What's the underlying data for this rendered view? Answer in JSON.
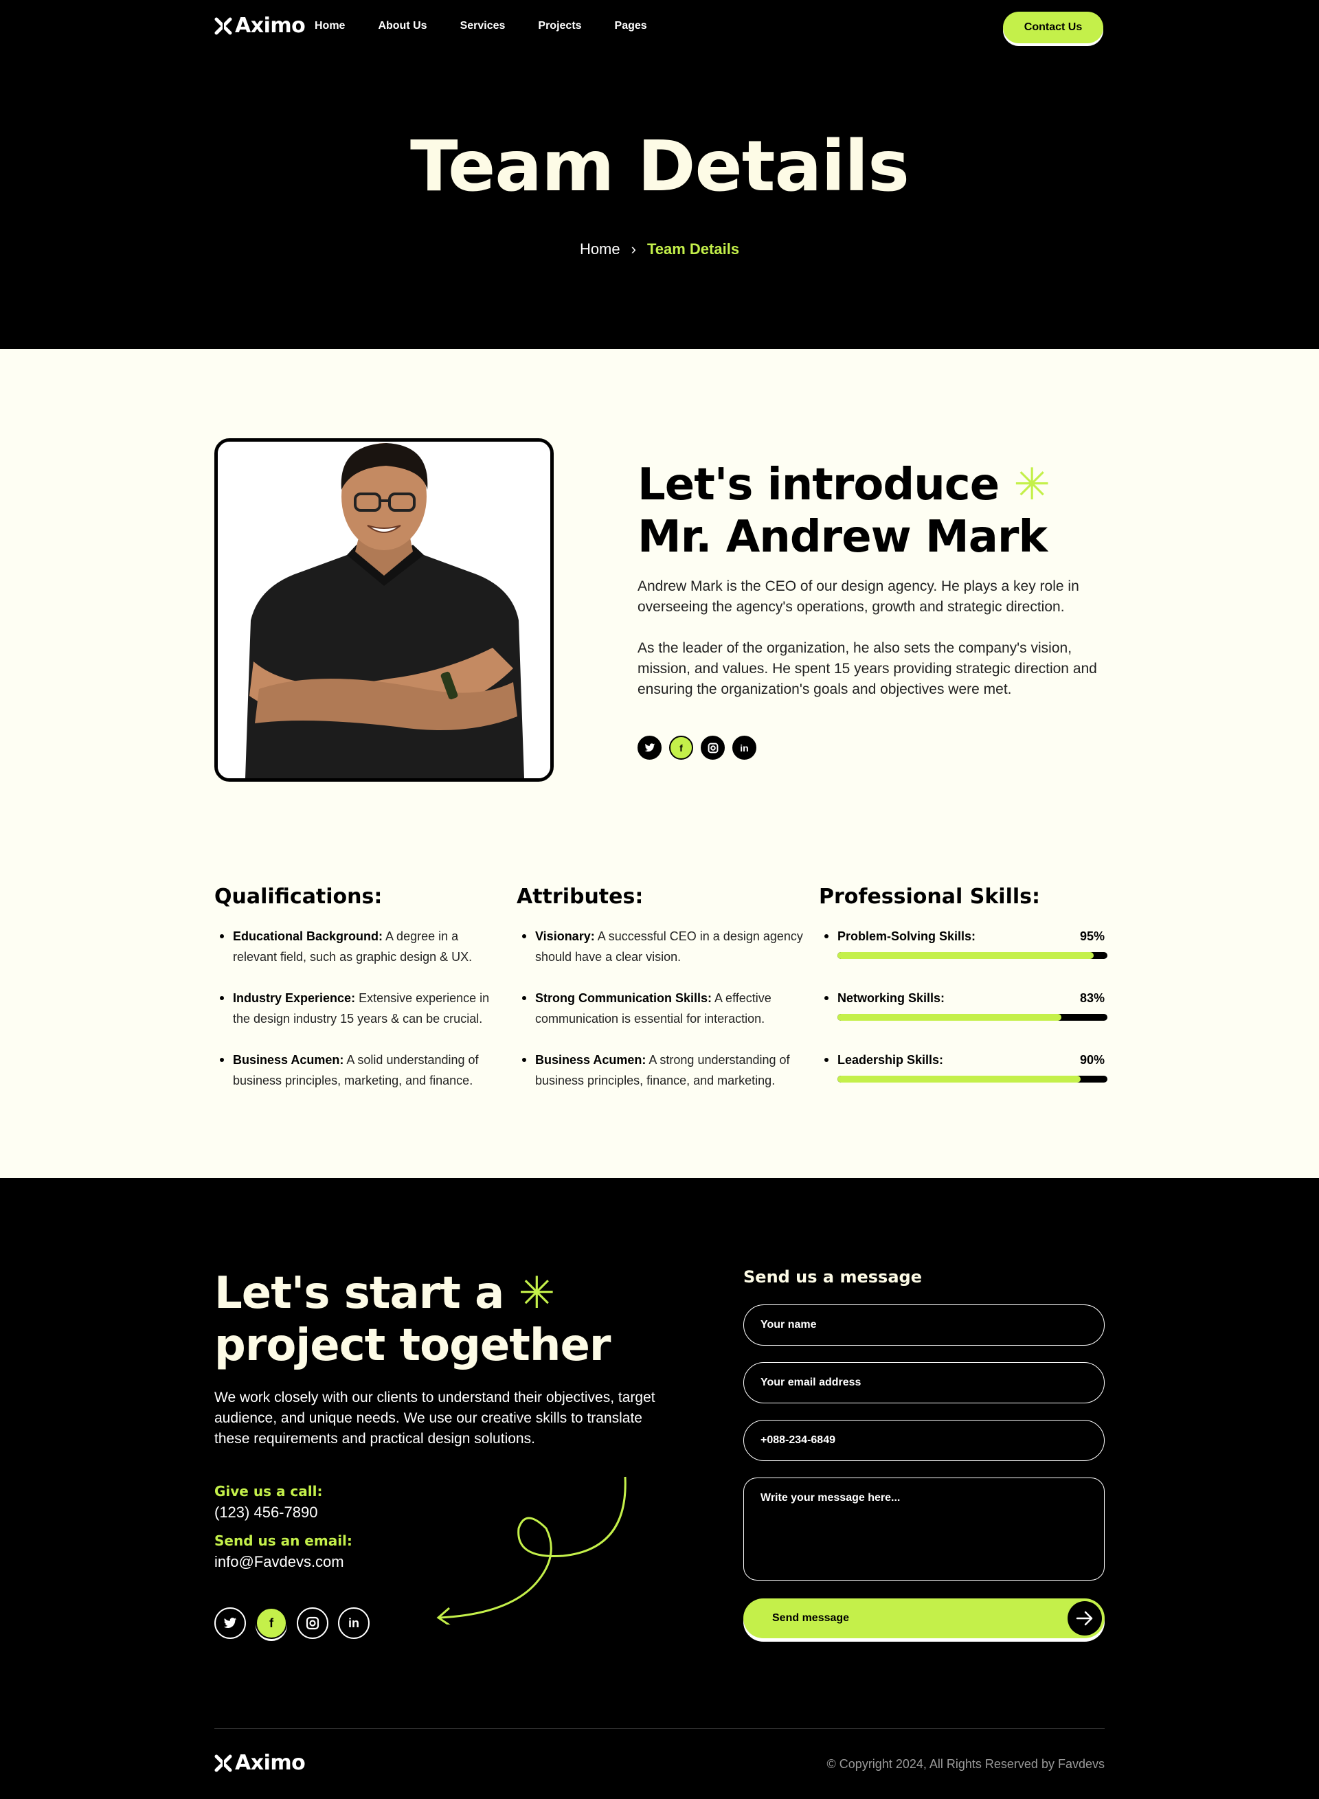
{
  "header": {
    "logo": "Aximo",
    "nav": [
      "Home",
      "About Us",
      "Services",
      "Projects",
      "Pages"
    ],
    "contact_button": "Contact Us",
    "title": "Team Details",
    "breadcrumb": {
      "home": "Home",
      "separator": "›",
      "current": "Team Details"
    }
  },
  "intro": {
    "title_line1": "Let's introduce",
    "title_line2": "Mr. Andrew Mark",
    "paragraph1": "Andrew Mark is the CEO of our design agency. He plays a key role in overseeing the agency's operations, growth and strategic direction.",
    "paragraph2": "As the leader of the organization, he also sets the company's vision, mission, and values. He spent 15 years providing strategic direction and ensuring the organization's goals and objectives were met.",
    "socials": [
      "twitter-icon",
      "facebook-icon",
      "instagram-icon",
      "linkedin-icon"
    ]
  },
  "qualifications": {
    "title": "Qualifications:",
    "items": [
      {
        "term": "Educational Background:",
        "text": "A degree in a relevant field, such as graphic design & UX."
      },
      {
        "term": "Industry Experience:",
        "text": "Extensive experience in the design industry 15 years & can be crucial."
      },
      {
        "term": "Business Acumen:",
        "text": "A solid understanding of business principles, marketing, and finance."
      }
    ]
  },
  "attributes": {
    "title": "Attributes:",
    "items": [
      {
        "term": "Visionary:",
        "text": "A successful CEO in a design agency should have a clear vision."
      },
      {
        "term": "Strong Communication Skills:",
        "text": "A effective communication is essential for interaction."
      },
      {
        "term": "Business Acumen:",
        "text": "A strong understanding of business principles, finance, and marketing."
      }
    ]
  },
  "skills": {
    "title": "Professional Skills:",
    "items": [
      {
        "name": "Problem-Solving Skills:",
        "percent_label": "95%",
        "value": 95
      },
      {
        "name": "Networking Skills:",
        "percent_label": "83%",
        "value": 83
      },
      {
        "name": "Leadership Skills:",
        "percent_label": "90%",
        "value": 90
      }
    ]
  },
  "contact": {
    "title_line1": "Let's start a",
    "title_line2": "project together",
    "paragraph": "We work closely with our clients to understand their objectives, target audience, and unique needs. We use our creative skills to translate these requirements and practical design solutions.",
    "call_label": "Give us a call:",
    "phone": "(123) 456-7890",
    "email_label": "Send us an email:",
    "email": "info@Favdevs.com",
    "form": {
      "title": "Send us a message",
      "name_placeholder": "Your name",
      "email_placeholder": "Your email address",
      "phone_placeholder": "+088-234-6849",
      "message_placeholder": "Write your message here...",
      "submit": "Send message"
    }
  },
  "footer": {
    "logo": "Aximo",
    "copyright": "© Copyright 2024, All Rights Reserved by Favdevs"
  },
  "colors": {
    "accent": "#c4f04a",
    "dark": "#000000",
    "cream": "#fefef3",
    "title_cream": "#fdfbe6"
  }
}
